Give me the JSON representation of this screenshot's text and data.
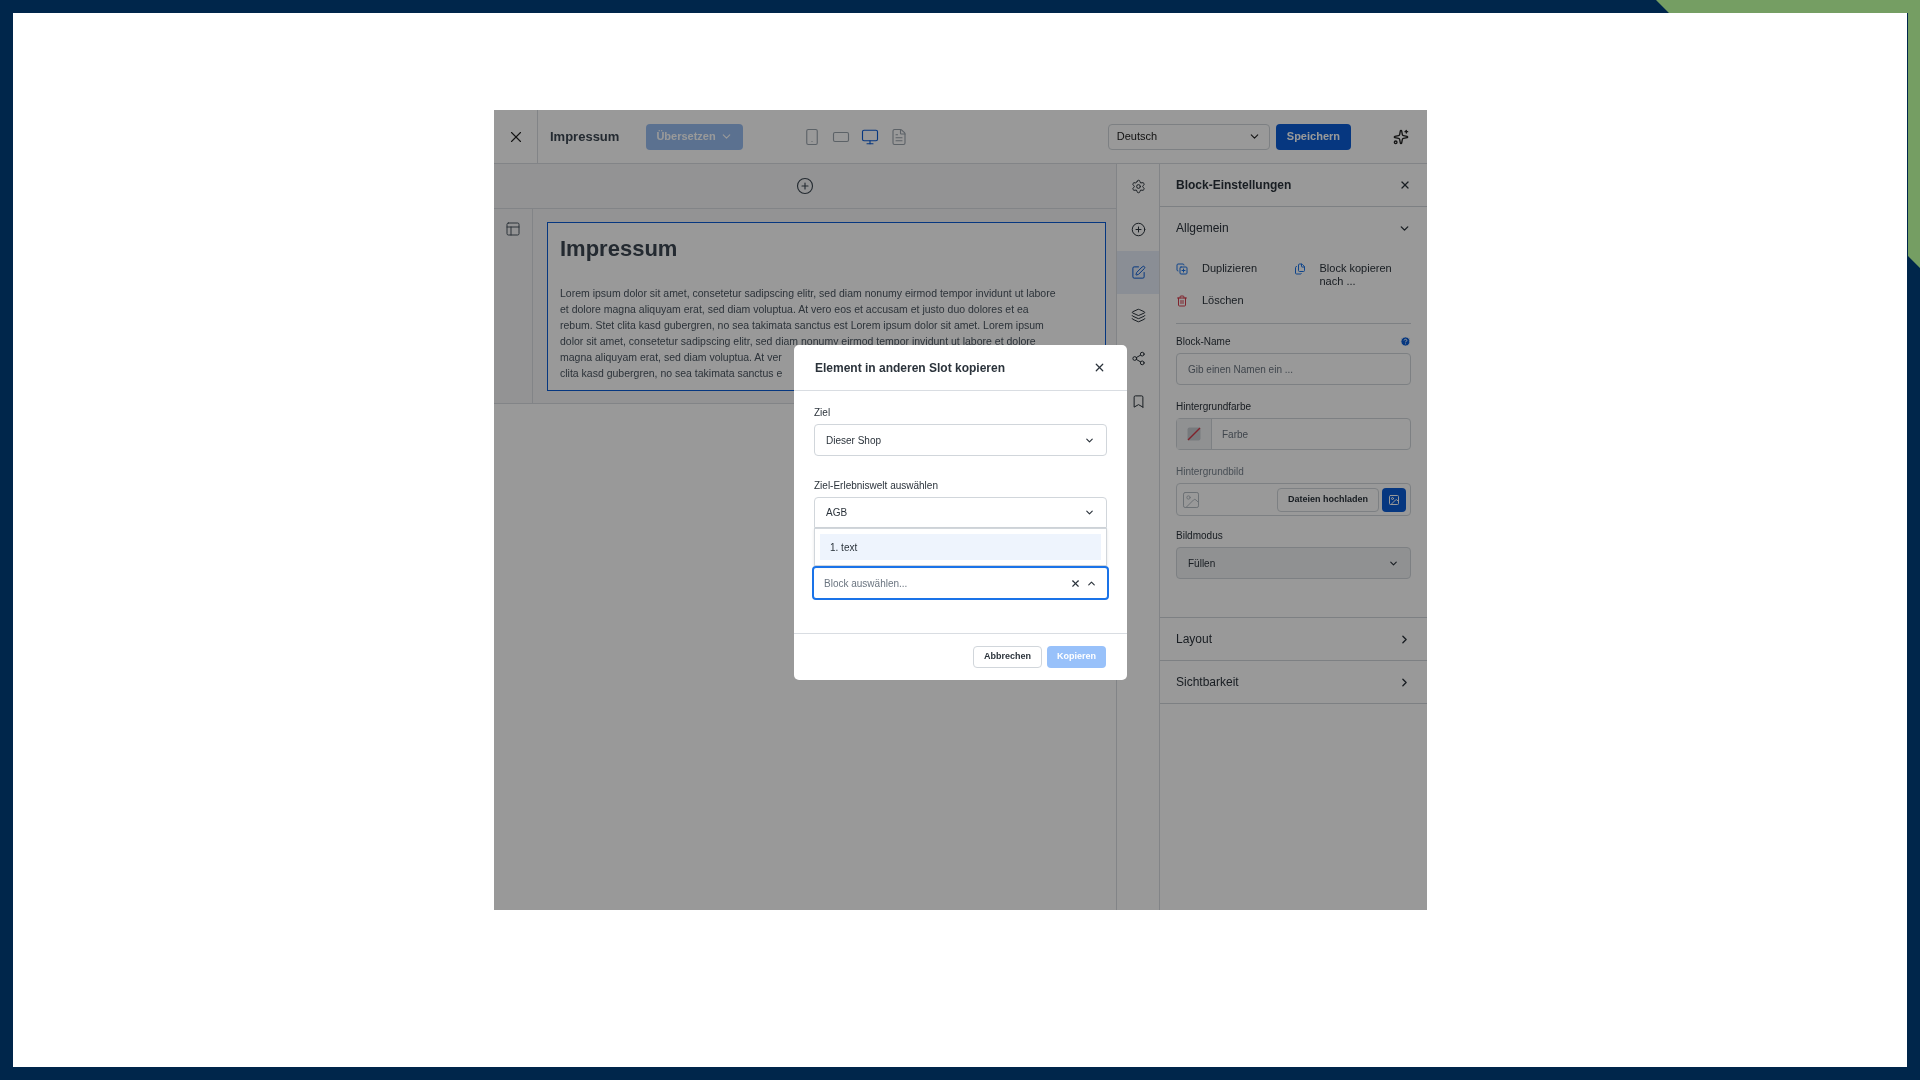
{
  "toolbar": {
    "title": "Impressum",
    "translate_button": {
      "label": "Übersetzen",
      "disabled": true
    },
    "devices": [
      {
        "kind": "mobile",
        "selected": false
      },
      {
        "kind": "tablet",
        "selected": false
      },
      {
        "kind": "desktop",
        "selected": true
      },
      {
        "kind": "list",
        "selected": false
      }
    ],
    "language": "Deutsch",
    "save_button": "Speichern"
  },
  "canvas": {
    "heading": "Impressum",
    "paragraph_lines": [
      "Lorem ipsum dolor sit amet, consetetur sadipscing elitr, sed diam nonumy eirmod tempor invidunt ut labore",
      "et dolore magna aliquyam erat, sed diam voluptua. At vero eos et accusam et justo duo dolores et ea",
      "rebum. Stet clita kasd gubergren, no sea takimata sanctus est Lorem ipsum dolor sit amet. Lorem ipsum",
      "dolor sit amet, consetetur sadipscing elitr, sed diam nonumy eirmod tempor invidunt ut labore et dolore",
      "magna aliquyam erat, sed diam voluptua. At ver",
      "clita kasd gubergren, no sea takimata sanctus e"
    ]
  },
  "sidebar_tabs": [
    {
      "kind": "settings",
      "selected": false
    },
    {
      "kind": "add",
      "selected": false
    },
    {
      "kind": "edit",
      "selected": true
    },
    {
      "kind": "layers",
      "selected": false
    },
    {
      "kind": "share",
      "selected": false
    },
    {
      "kind": "bookmark",
      "selected": false
    }
  ],
  "settings_panel": {
    "title": "Block-Einstellungen",
    "sections": [
      {
        "title": "Allgemein",
        "expanded": true
      },
      {
        "title": "Layout",
        "expanded": false
      },
      {
        "title": "Sichtbarkeit",
        "expanded": false
      }
    ],
    "actions": [
      {
        "kind": "duplicate",
        "label": "Duplizieren"
      },
      {
        "kind": "copy",
        "label": "Block kopieren nach ..."
      },
      {
        "kind": "delete",
        "label": "Löschen"
      }
    ],
    "block_name": {
      "label": "Block-Name",
      "placeholder": "Gib einen Namen ein ..."
    },
    "background_color": {
      "label": "Hintergrundfarbe",
      "placeholder": "Farbe"
    },
    "background_image": {
      "label": "Hintergrundbild",
      "upload_button": "Dateien hochladen"
    },
    "image_mode": {
      "label": "Bildmodus",
      "value": "Füllen"
    }
  },
  "dialog": {
    "title": "Element in anderen Slot kopieren",
    "target": {
      "label": "Ziel",
      "value": "Dieser Shop"
    },
    "world": {
      "label": "Ziel-Erlebniswelt auswählen",
      "value": "AGB"
    },
    "block": {
      "placeholder": "Block auswählen...",
      "open": true,
      "options": [
        {
          "label": "1. text",
          "highlighted": true
        }
      ]
    },
    "cancel_button": "Abbrechen",
    "copy_button": {
      "label": "Kopieren",
      "disabled": true
    }
  }
}
